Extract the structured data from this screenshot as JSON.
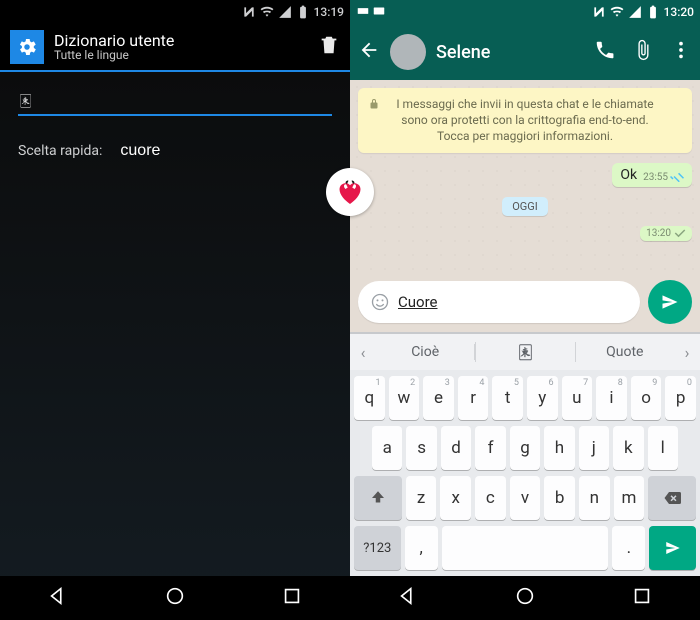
{
  "left": {
    "status": {
      "time": "13:19"
    },
    "appbar": {
      "title": "Dizionario utente",
      "subtitle": "Tutte le lingue"
    },
    "word_value": "🀀",
    "shortcut_label": "Scelta rapida:",
    "shortcut_value": "cuore"
  },
  "right": {
    "status": {
      "time": "13:20"
    },
    "appbar": {
      "title": "Selene"
    },
    "encryption_notice": "I messaggi che invii in questa chat e le chiamate sono ora protetti con la crittografia end-to-end. Tocca per maggiori informazioni.",
    "msg1": {
      "text": "Ok",
      "time": "23:55"
    },
    "date_separator": "OGGI",
    "msg2": {
      "time": "13:20"
    },
    "input_text": "Cuore",
    "suggestions": {
      "s1": "Cioè",
      "s2": "🀀",
      "s3": "Quote"
    },
    "keyboard": {
      "row1": [
        {
          "k": "q",
          "h": "1"
        },
        {
          "k": "w",
          "h": "2"
        },
        {
          "k": "e",
          "h": "3"
        },
        {
          "k": "r",
          "h": "4"
        },
        {
          "k": "t",
          "h": "5"
        },
        {
          "k": "y",
          "h": "6"
        },
        {
          "k": "u",
          "h": "7"
        },
        {
          "k": "i",
          "h": "8"
        },
        {
          "k": "o",
          "h": "9"
        },
        {
          "k": "p",
          "h": "0"
        }
      ],
      "row2": [
        "a",
        "s",
        "d",
        "f",
        "g",
        "h",
        "j",
        "k",
        "l"
      ],
      "row3": [
        "z",
        "x",
        "c",
        "v",
        "b",
        "n",
        "m"
      ],
      "sym": "?123",
      "comma": ",",
      "dot": "."
    }
  }
}
